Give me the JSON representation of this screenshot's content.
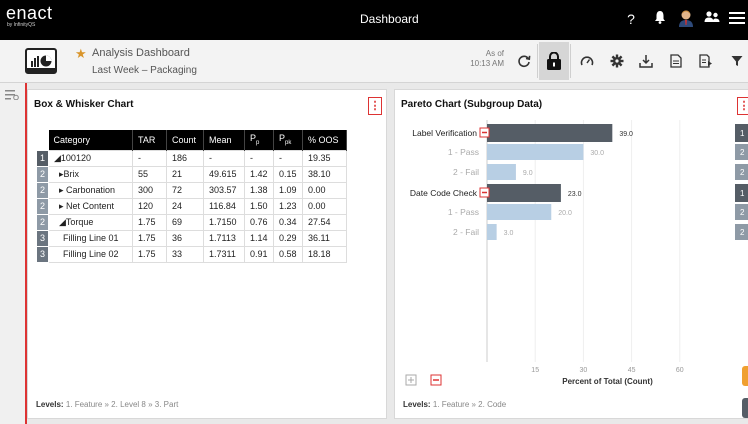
{
  "app": {
    "logo": "enact",
    "logo_sub": "by InfinityQS",
    "title": "Dashboard"
  },
  "toolbar": {
    "title": "Analysis Dashboard",
    "subtitle": "Last Week – Packaging",
    "as_of_label": "As of",
    "as_of_time": "10:13 AM"
  },
  "box_whisker": {
    "title": "Box & Whisker Chart",
    "menu": "⋮",
    "headers": [
      "Category",
      "TAR",
      "Count",
      "Mean",
      "Pp",
      "Ppk",
      "% OOS"
    ],
    "rows": [
      {
        "level": "1",
        "category": "◢100120",
        "tar": "-",
        "count": "186",
        "mean": "-",
        "pp": "-",
        "ppk": "-",
        "oos": "19.35"
      },
      {
        "level": "2",
        "category": "▸Brix",
        "tar": "55",
        "count": "21",
        "mean": "49.615",
        "pp": "1.42",
        "ppk": "0.15",
        "oos": "38.10"
      },
      {
        "level": "2",
        "category": "▸ Carbonation",
        "tar": "300",
        "count": "72",
        "mean": "303.57",
        "pp": "1.38",
        "ppk": "1.09",
        "oos": "0.00"
      },
      {
        "level": "2",
        "category": "▸ Net Content",
        "tar": "120",
        "count": "24",
        "mean": "116.84",
        "pp": "1.50",
        "ppk": "1.23",
        "oos": "0.00"
      },
      {
        "level": "2",
        "category": "◢Torque",
        "tar": "1.75",
        "count": "69",
        "mean": "1.7150",
        "pp": "0.76",
        "ppk": "0.34",
        "oos": "27.54"
      },
      {
        "level": "3",
        "category": "Filling Line 01",
        "tar": "1.75",
        "count": "36",
        "mean": "1.7113",
        "pp": "1.14",
        "ppk": "0.29",
        "oos": "36.11"
      },
      {
        "level": "3",
        "category": "Filling Line 02",
        "tar": "1.75",
        "count": "33",
        "mean": "1.7311",
        "pp": "0.91",
        "ppk": "0.58",
        "oos": "18.18"
      }
    ],
    "levels_label": "Levels:",
    "levels_text": "1. Feature » 2. Level 8 » 3. Part"
  },
  "pareto": {
    "title": "Pareto Chart (Subgroup Data)",
    "menu": "⋮",
    "levels_label": "Levels:",
    "levels_text": "1. Feature » 2. Code"
  },
  "chart_data": {
    "type": "bar",
    "orientation": "horizontal",
    "categories": [
      "Label Verification",
      "1 - Pass",
      "2 - Fail",
      "Date Code Check",
      "1 - Pass",
      "2 - Fail"
    ],
    "values": [
      39.0,
      30.0,
      9.0,
      23.0,
      20.0,
      3.0
    ],
    "levels": [
      1,
      2,
      2,
      1,
      2,
      2
    ],
    "colors": [
      "#555d66",
      "#b8cfe4",
      "#b8cfe4",
      "#555d66",
      "#b8cfe4",
      "#b8cfe4"
    ],
    "xlabel": "Percent of Total (Count)",
    "xticks": [
      "15",
      "30",
      "45",
      "60"
    ],
    "xlim": [
      0,
      75
    ]
  },
  "colors": {
    "accent_red": "#dd3333",
    "star": "#d9952b",
    "bar_level1": "#555d66",
    "bar_level2": "#b8cfe4"
  }
}
